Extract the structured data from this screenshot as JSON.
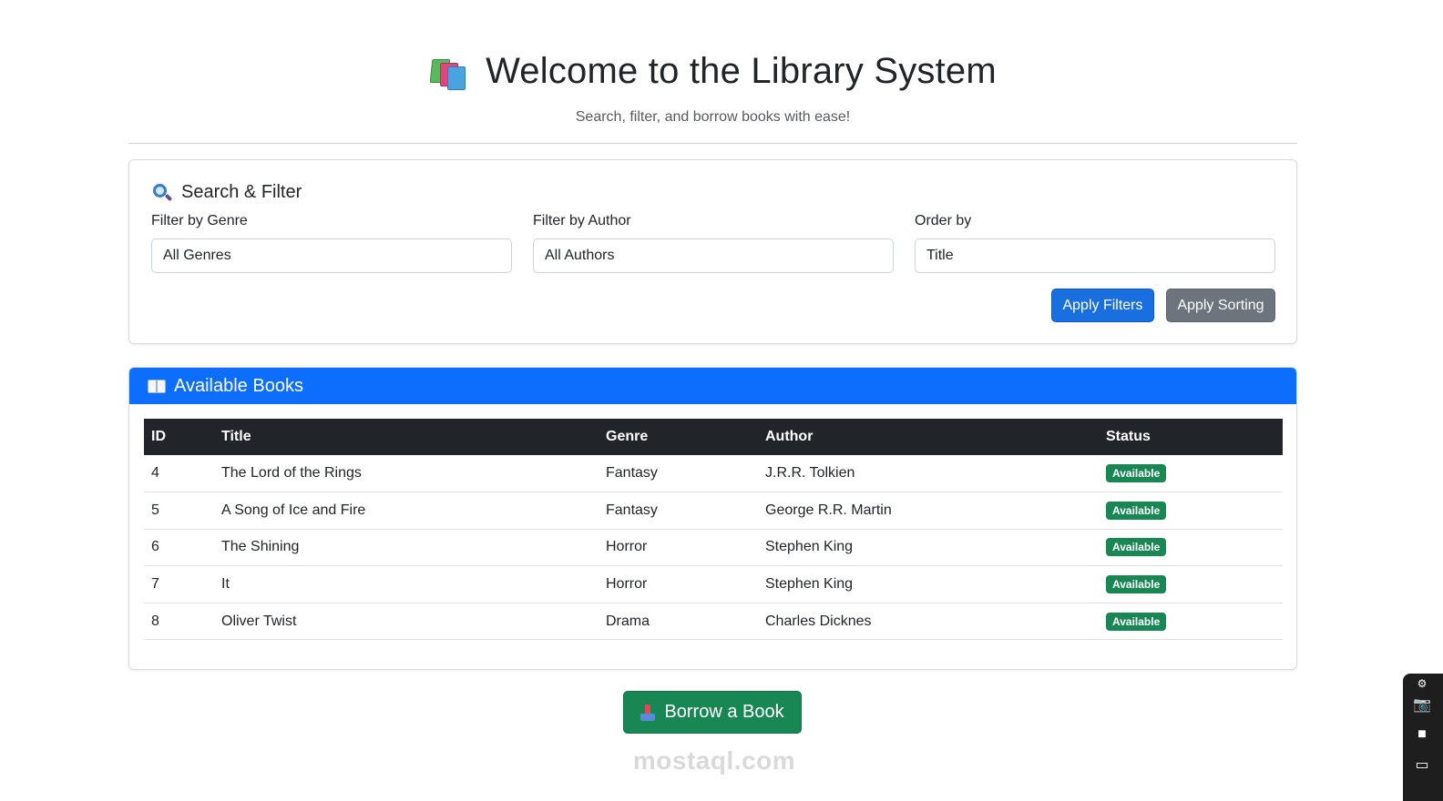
{
  "header": {
    "title": "Welcome to the Library System",
    "subtitle": "Search, filter, and borrow books with ease!",
    "title_icon": "books-icon"
  },
  "filters": {
    "heading": "Search & Filter",
    "heading_icon": "magnifier-icon",
    "genre": {
      "label": "Filter by Genre",
      "value": "All Genres"
    },
    "author": {
      "label": "Filter by Author",
      "value": "All Authors"
    },
    "order": {
      "label": "Order by",
      "value": "Title"
    },
    "apply_filters_label": "Apply Filters",
    "apply_sorting_label": "Apply Sorting"
  },
  "books": {
    "heading": "Available Books",
    "heading_icon": "open-book-icon",
    "columns": [
      "ID",
      "Title",
      "Genre",
      "Author",
      "Status"
    ],
    "rows": [
      {
        "id": "4",
        "title": "The Lord of the Rings",
        "genre": "Fantasy",
        "author": "J.R.R. Tolkien",
        "status": "Available"
      },
      {
        "id": "5",
        "title": "A Song of Ice and Fire",
        "genre": "Fantasy",
        "author": "George R.R. Martin",
        "status": "Available"
      },
      {
        "id": "6",
        "title": "The Shining",
        "genre": "Horror",
        "author": "Stephen King",
        "status": "Available"
      },
      {
        "id": "7",
        "title": "It",
        "genre": "Horror",
        "author": "Stephen King",
        "status": "Available"
      },
      {
        "id": "8",
        "title": "Oliver Twist",
        "genre": "Drama",
        "author": "Charles Dicknes",
        "status": "Available"
      }
    ]
  },
  "borrow": {
    "label": "Borrow a Book",
    "icon": "inbox-tray-icon"
  },
  "watermark": "mostaql.com",
  "colors": {
    "primary": "#0d6efd",
    "secondary": "#6c757d",
    "success": "#198754",
    "dark": "#212529"
  }
}
